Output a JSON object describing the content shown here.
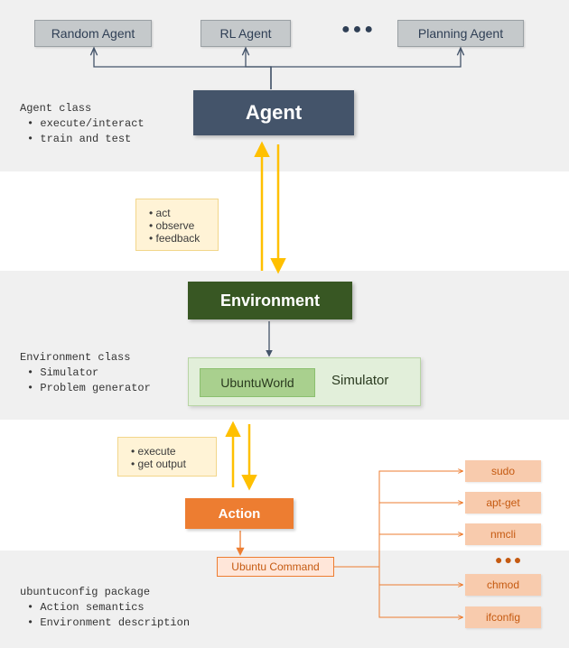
{
  "top": {
    "agent": "Agent",
    "subagents": {
      "random": "Random Agent",
      "rl": "RL Agent",
      "plan": "Planning Agent"
    },
    "ellipsis": "●●●",
    "desc_title": "Agent class",
    "desc_items": [
      "execute/interact",
      "train and test"
    ]
  },
  "note_agent_env": {
    "items": [
      "act",
      "observe",
      "feedback"
    ]
  },
  "mid": {
    "env": "Environment",
    "ubuntu_world": "UbuntuWorld",
    "simulator": "Simulator",
    "desc_title": "Environment class",
    "desc_items": [
      "Simulator",
      "Problem generator"
    ]
  },
  "note_env_action": {
    "items": [
      "execute",
      "get output"
    ]
  },
  "action": {
    "label": "Action",
    "ubuntu_cmd": "Ubuntu Command",
    "commands": {
      "sudo": "sudo",
      "apt": "apt-get",
      "nmcli": "nmcli",
      "chmod": "chmod",
      "ifconfig": "ifconfig"
    },
    "ellipsis": "●●●"
  },
  "bottom_desc": {
    "title": "ubuntuconfig package",
    "items": [
      "Action semantics",
      "Environment description"
    ]
  },
  "colors": {
    "navy": "#44546a",
    "green": "#385723",
    "orange": "#ed7d31",
    "gold_arrow": "#ffc000",
    "slate_arrow": "#44546a"
  }
}
